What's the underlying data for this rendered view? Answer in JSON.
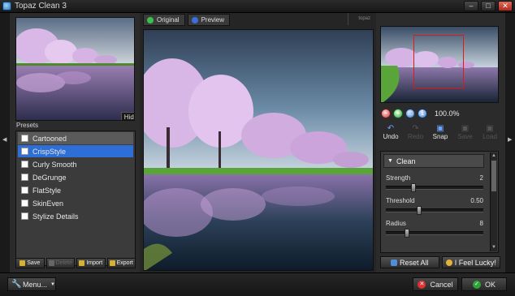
{
  "window": {
    "title": "Topaz Clean 3",
    "controls": [
      "–",
      "□",
      "✕"
    ]
  },
  "left": {
    "hide_label": "Hide",
    "presets_label": "Presets",
    "presets": [
      {
        "label": "Cartooned",
        "state": "dim"
      },
      {
        "label": "CrispStyle",
        "state": "selected"
      },
      {
        "label": "Curly Smooth",
        "state": ""
      },
      {
        "label": "DeGrunge",
        "state": ""
      },
      {
        "label": "FlatStyle",
        "state": ""
      },
      {
        "label": "SkinEven",
        "state": ""
      },
      {
        "label": "Stylize Details",
        "state": ""
      }
    ],
    "toolbar": {
      "save": "Save",
      "delete": "Delete",
      "import": "Import",
      "export": "Export"
    }
  },
  "center": {
    "tab_original": "Original",
    "tab_preview": "Preview",
    "badge": "topaz"
  },
  "right": {
    "zoom_value": "100.0%",
    "actions": {
      "undo": "Undo",
      "redo": "Redo",
      "snap": "Snap",
      "save": "Save",
      "load": "Load"
    },
    "section_title": "Clean",
    "sliders": [
      {
        "label": "Strength",
        "value": "2",
        "fraction": 0.27
      },
      {
        "label": "Threshold",
        "value": "0.50",
        "fraction": 0.33
      },
      {
        "label": "Radius",
        "value": "8",
        "fraction": 0.2
      }
    ],
    "reset_label": "Reset All",
    "lucky_label": "I Feel Lucky!"
  },
  "bottom": {
    "menu_label": "Menu...",
    "cancel_label": "Cancel",
    "ok_label": "OK"
  },
  "colors": {
    "selection": "#2d6fd6",
    "nav_rect": "#e01818",
    "panel": "#2b2b2b"
  }
}
